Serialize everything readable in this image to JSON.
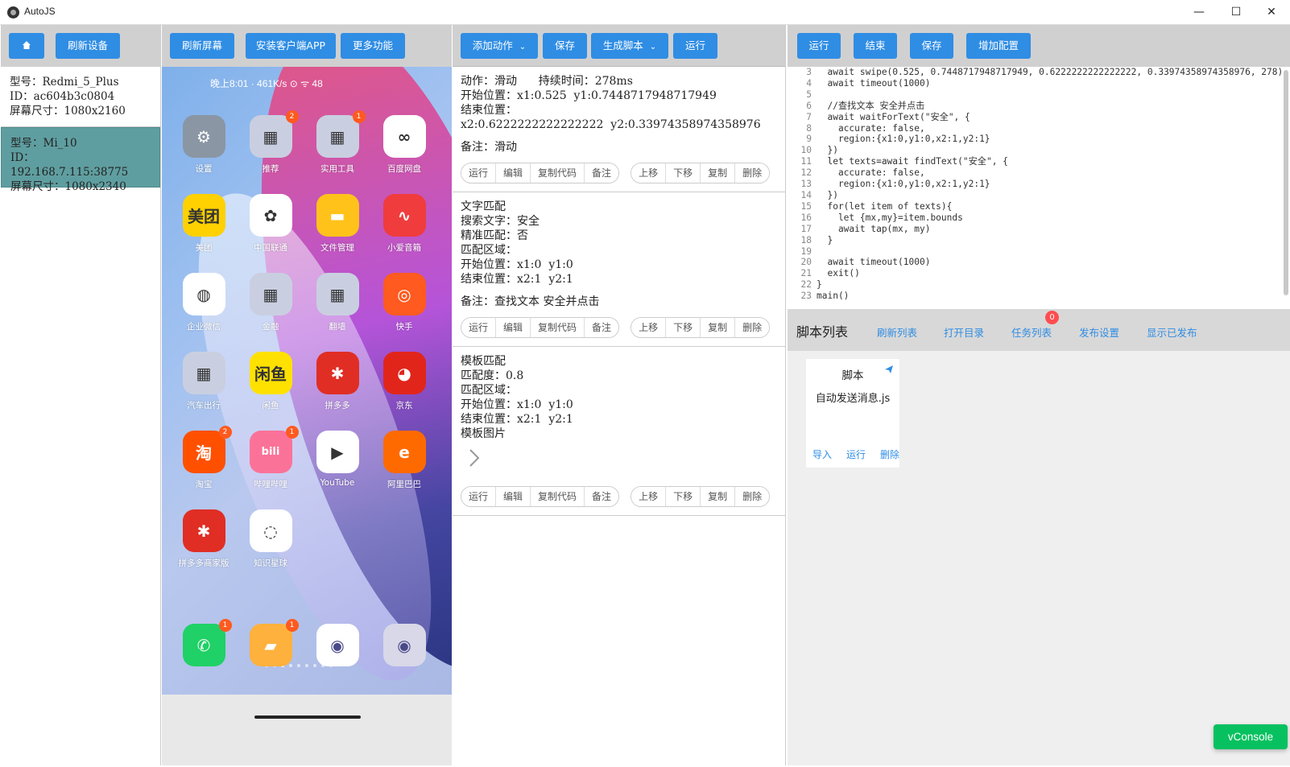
{
  "window": {
    "title": "AutoJS",
    "minimize_glyph": "—",
    "maximize_glyph": "☐",
    "close_glyph": "✕"
  },
  "devices_panel": {
    "home_icon": "home-icon",
    "refresh_devices_label": "刷新设备",
    "devices": [
      {
        "model": "型号：Redmi_5_Plus",
        "id": "ID：ac604b3c0804",
        "screen": "屏幕尺寸：1080x2160",
        "selected": false
      },
      {
        "model": "型号：Mi_10",
        "id": "ID：192.168.7.115:38775",
        "screen": "屏幕尺寸：1080x2340",
        "selected": true
      }
    ]
  },
  "screen_panel": {
    "refresh_screen_label": "刷新屏幕",
    "install_client_label": "安装客户端APP",
    "more_label": "更多功能",
    "status_bar": "晚上8:01  ·  461K/s  ⊙  ᯤ  48",
    "apps": [
      {
        "label": "设置",
        "glyph": "⚙",
        "color": "#8a96a3",
        "badge": ""
      },
      {
        "label": "推荐",
        "glyph": "▦",
        "color": "#c9cfe0",
        "badge": "2"
      },
      {
        "label": "实用工具",
        "glyph": "▦",
        "color": "#c9cfe0",
        "badge": "1"
      },
      {
        "label": "百度网盘",
        "glyph": "∞",
        "color": "#ffffff",
        "badge": ""
      },
      {
        "label": "美团",
        "glyph": "美团",
        "color": "#ffd100",
        "badge": ""
      },
      {
        "label": "中国联通",
        "glyph": "✿",
        "color": "#ffffff",
        "badge": ""
      },
      {
        "label": "文件管理",
        "glyph": "▬",
        "color": "#ffc21a",
        "badge": ""
      },
      {
        "label": "小爱音箱",
        "glyph": "∿",
        "color": "#f03c3c",
        "badge": ""
      },
      {
        "label": "企业微信",
        "glyph": "◍",
        "color": "#ffffff",
        "badge": ""
      },
      {
        "label": "金融",
        "glyph": "▦",
        "color": "#c9cfe0",
        "badge": ""
      },
      {
        "label": "翻墙",
        "glyph": "▦",
        "color": "#c9cfe0",
        "badge": ""
      },
      {
        "label": "快手",
        "glyph": "◎",
        "color": "#ff5a1f",
        "badge": ""
      },
      {
        "label": "汽车出行",
        "glyph": "▦",
        "color": "#c9cfe0",
        "badge": ""
      },
      {
        "label": "闲鱼",
        "glyph": "闲鱼",
        "color": "#ffe100",
        "badge": ""
      },
      {
        "label": "拼多多",
        "glyph": "✱",
        "color": "#e02e24",
        "badge": ""
      },
      {
        "label": "京东",
        "glyph": "◕",
        "color": "#e1251b",
        "badge": ""
      },
      {
        "label": "淘宝",
        "glyph": "淘",
        "color": "#ff5000",
        "badge": "2"
      },
      {
        "label": "哔哩哔哩",
        "glyph": "bili",
        "color": "#fb7299",
        "badge": "1"
      },
      {
        "label": "YouTube",
        "glyph": "▶",
        "color": "#ffffff",
        "badge": ""
      },
      {
        "label": "阿里巴巴",
        "glyph": "e",
        "color": "#ff6a00",
        "badge": ""
      },
      {
        "label": "拼多多商家版",
        "glyph": "✱",
        "color": "#e02e24",
        "badge": ""
      },
      {
        "label": "知识星球",
        "glyph": "◌",
        "color": "#ffffff",
        "badge": ""
      }
    ],
    "dock": [
      {
        "glyph": "✆",
        "color": "#1fd166",
        "badge": "1"
      },
      {
        "glyph": "▰",
        "color": "#ffb13d",
        "badge": "1"
      },
      {
        "glyph": "◉",
        "color": "#ffffff",
        "badge": ""
      },
      {
        "glyph": "◉",
        "color": "#d8d8e8",
        "badge": ""
      }
    ]
  },
  "actions_panel": {
    "add_action_label": "添加动作",
    "save_label": "保存",
    "gen_script_label": "生成脚本",
    "run_label": "运行",
    "op_labels": {
      "run": "运行",
      "edit": "编辑",
      "copy_code": "复制代码",
      "note": "备注",
      "up": "上移",
      "down": "下移",
      "copy": "复制",
      "delete": "删除"
    },
    "actions": [
      {
        "lines": [
          "动作：滑动      持续时间：278ms",
          "开始位置：x1:0.525  y1:0.7448717948717949",
          "结束位置：",
          "x2:0.6222222222222222  y2:0.33974358974358976"
        ],
        "note": "备注：滑动",
        "has_image": false
      },
      {
        "lines": [
          "文字匹配",
          "搜索文字：安全",
          "精准匹配：否",
          "匹配区域：",
          "开始位置：x1:0  y1:0",
          "结束位置：x2:1  y2:1"
        ],
        "note": "备注：查找文本 安全并点击",
        "has_image": false
      },
      {
        "lines": [
          "模板匹配",
          "匹配度：0.8",
          "匹配区域：",
          "开始位置：x1:0  y1:0",
          "结束位置：x2:1  y2:1",
          "模板图片"
        ],
        "note": "",
        "has_image": true
      }
    ]
  },
  "script_panel": {
    "run_label": "运行",
    "end_label": "结束",
    "save_label": "保存",
    "add_config_label": "增加配置",
    "line_numbers": "3\n4\n5\n6\n7\n8\n9\n10\n11\n12\n13\n14\n15\n16\n17\n18\n19\n20\n21\n22\n23",
    "code": "  await swipe(0.525, 0.7448717948717949, 0.6222222222222222, 0.33974358974358976, 278)\n  await timeout(1000)\n\n  //查找文本 安全并点击\n  await waitForText(\"安全\", {\n    accurate: false,\n    region:{x1:0,y1:0,x2:1,y2:1}\n  })\n  let texts=await findText(\"安全\", {\n    accurate: false,\n    region:{x1:0,y1:0,x2:1,y2:1}\n  })\n  for(let item of texts){\n    let {mx,my}=item.bounds\n    await tap(mx, my)\n  }\n\n  await timeout(1000)\n  exit()\n}\nmain()",
    "list_title": "脚本列表",
    "links": {
      "refresh": "刷新列表",
      "open_dir": "打开目录",
      "tasks": "任务列表",
      "tasks_badge": "0",
      "publish_settings": "发布设置",
      "show_published": "显示已发布"
    },
    "card": {
      "header": "脚本",
      "name": "自动发送消息.js",
      "import": "导入",
      "run": "运行",
      "delete": "删除"
    }
  },
  "vconsole_label": "vConsole"
}
